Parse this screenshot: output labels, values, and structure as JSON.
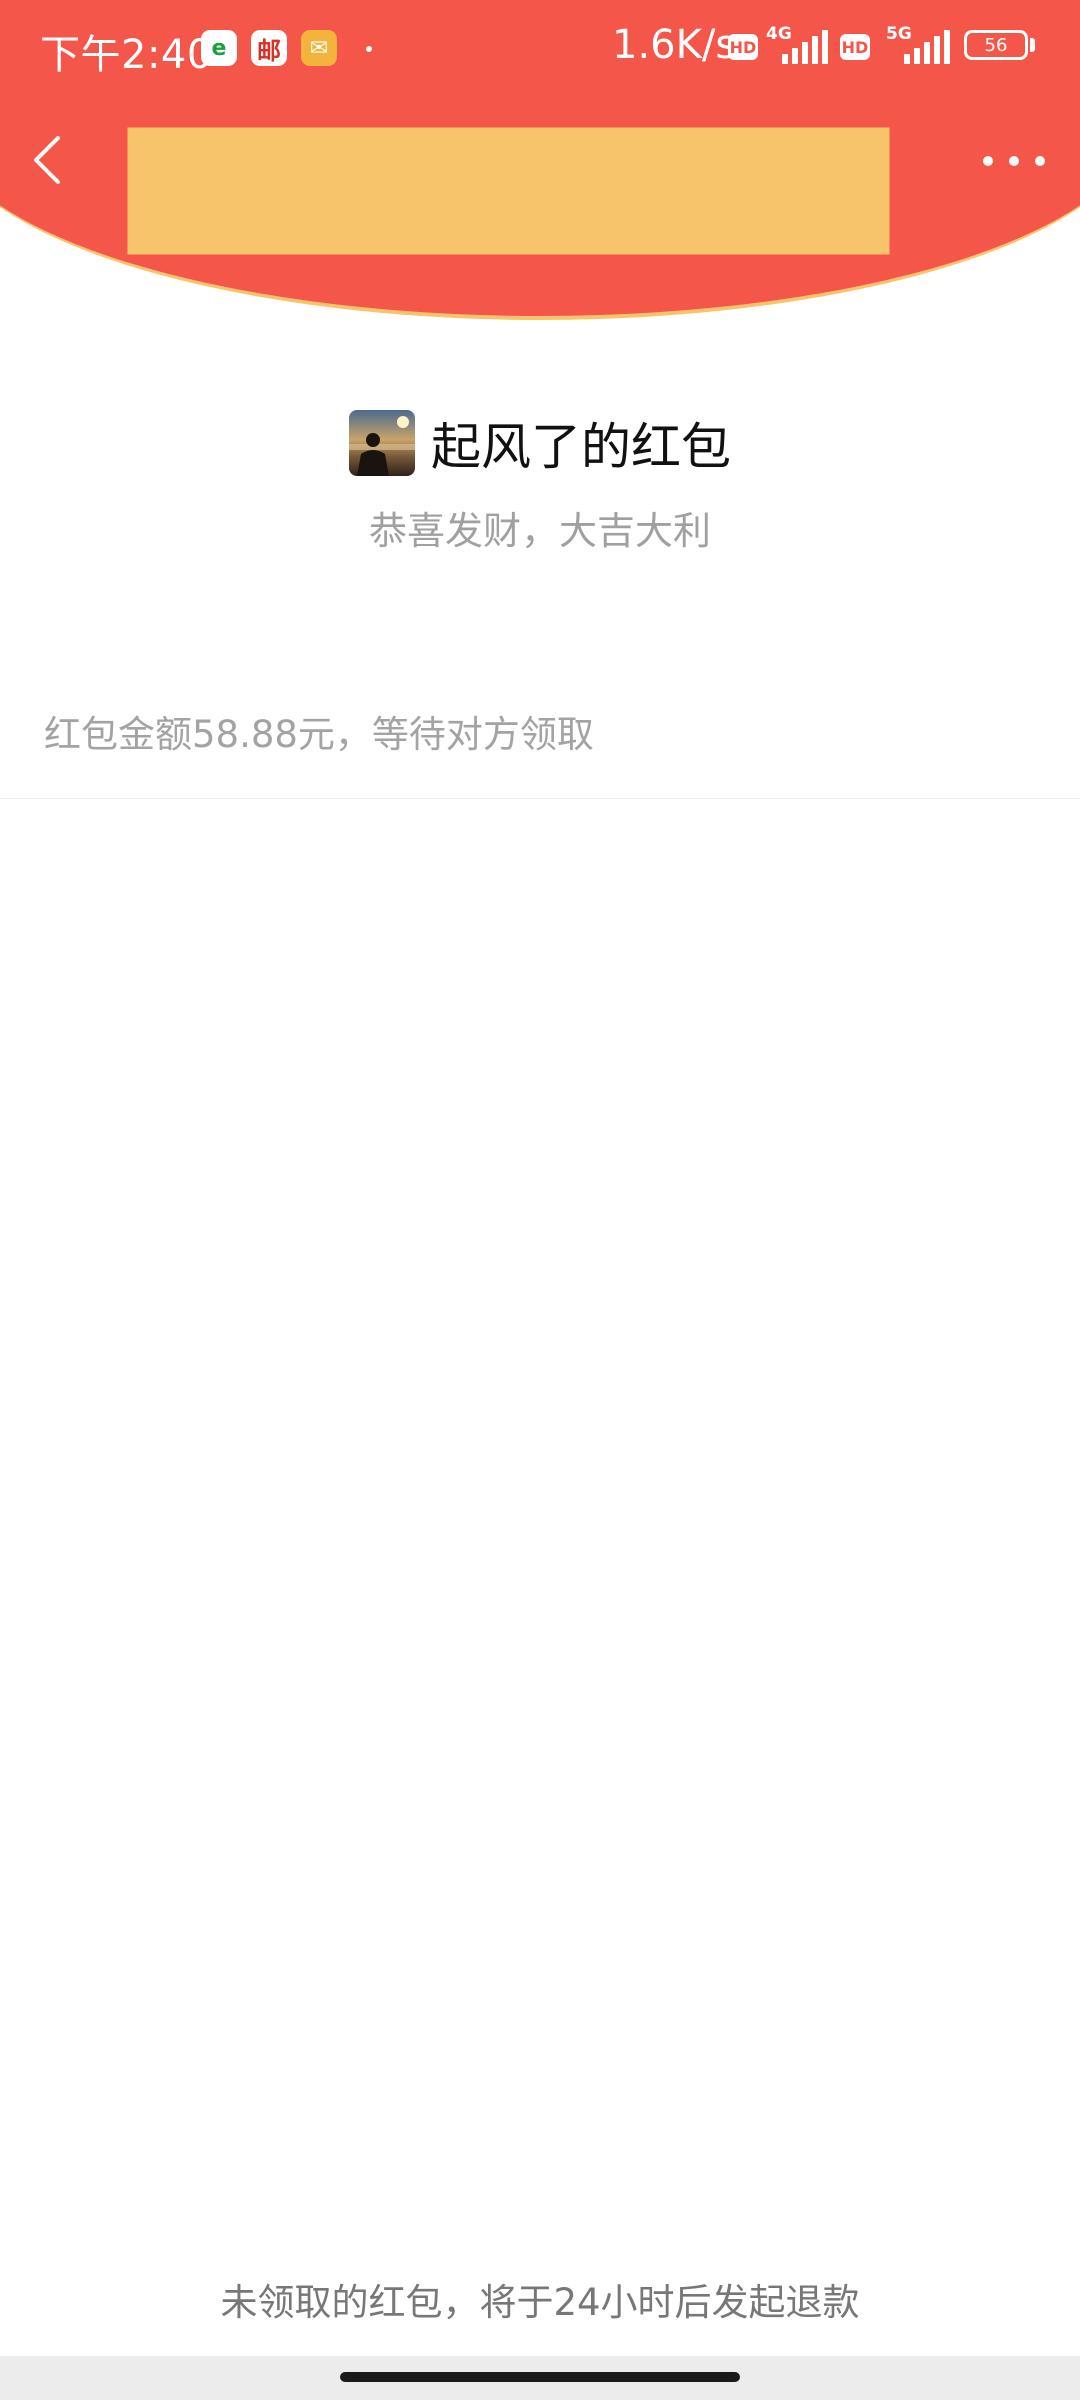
{
  "status_bar": {
    "time": "下午2:40",
    "browser_icon_glyph": "e",
    "mail_icon_glyph": "邮",
    "message_icon_glyph": "✉",
    "net_speed": "1.6K/s",
    "hd_label": "HD",
    "net_type_1": "4G",
    "net_type_2": "5G",
    "battery": "56"
  },
  "nav": {
    "back_icon": "chevron-left-icon",
    "more_icon": "more-dots-icon"
  },
  "envelope": {
    "sender_title": "起风了的红包",
    "blessing": "恭喜发财，大吉大利",
    "status": "红包金额58.88元，等待对方领取"
  },
  "footer": {
    "refund_note": "未领取的红包，将于24小时后发起退款"
  },
  "colors": {
    "header_red": "#f5564a",
    "header_rim": "#f7c46b",
    "title_text": "#111111",
    "muted_text": "#a0a0a0"
  }
}
